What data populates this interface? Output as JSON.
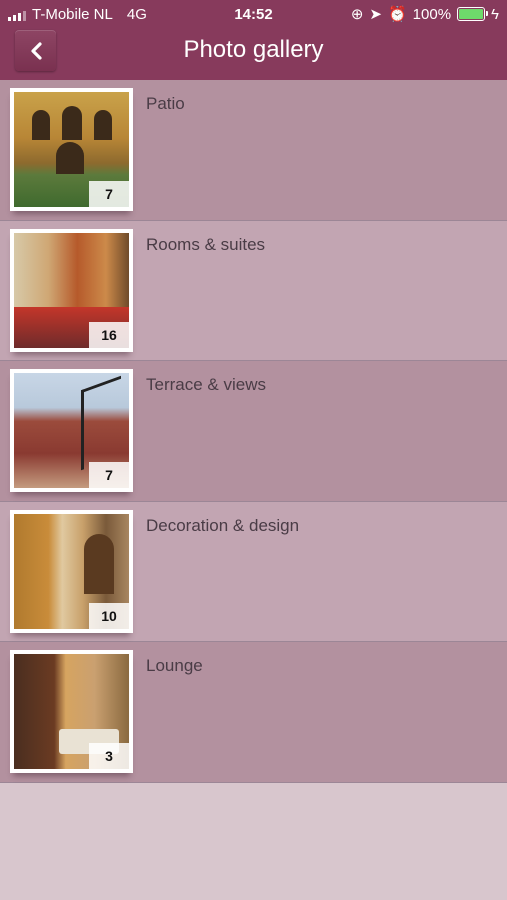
{
  "status_bar": {
    "carrier": "T-Mobile NL",
    "network": "4G",
    "time": "14:52",
    "battery": "100%"
  },
  "header": {
    "title": "Photo gallery",
    "back_icon": "chevron-left-icon"
  },
  "gallery": [
    {
      "label": "Patio",
      "count": "7"
    },
    {
      "label": "Rooms & suites",
      "count": "16"
    },
    {
      "label": "Terrace & views",
      "count": "7"
    },
    {
      "label": "Decoration & design",
      "count": "10"
    },
    {
      "label": "Lounge",
      "count": "3"
    }
  ],
  "colors": {
    "header": "#873a5c",
    "row_dark": "#b3919f",
    "row_light": "#c2a5b2",
    "background": "#d8c6cd"
  }
}
